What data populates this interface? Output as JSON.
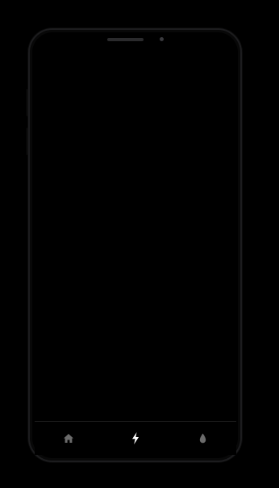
{
  "device": {
    "frame_color": "#1c1c1e",
    "screen_color": "#000000"
  },
  "tabbar": {
    "items": [
      {
        "name": "home",
        "icon": "home-icon",
        "active": false,
        "color": "#6b6b6b"
      },
      {
        "name": "power",
        "icon": "lightning-bolt-icon",
        "active": true,
        "color": "#ffffff"
      },
      {
        "name": "water",
        "icon": "water-drop-icon",
        "active": false,
        "color": "#6b6b6b"
      }
    ]
  }
}
